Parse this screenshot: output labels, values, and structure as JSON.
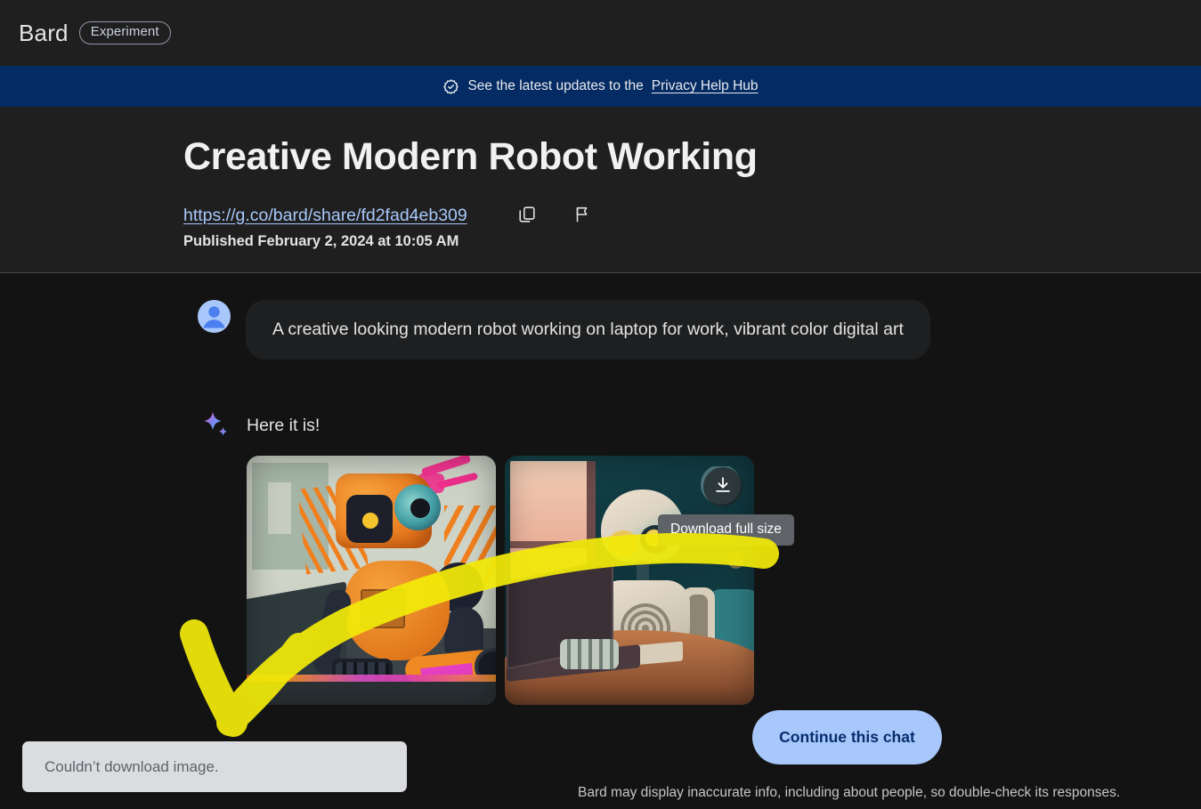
{
  "appbar": {
    "brand": "Bard",
    "chip": "Experiment",
    "brand_icon": "bard-logo"
  },
  "banner": {
    "icon": "verified-badge-icon",
    "text": "See the latest updates to the",
    "link": "Privacy Help Hub",
    "background_color": "#042b63"
  },
  "hero": {
    "title": "Creative Modern Robot Working",
    "share_url": "https://g.co/bard/share/fd2fad4eb309",
    "copy_icon": "copy-icon",
    "flag_icon": "flag-icon",
    "published": "Published February 2, 2024 at 10:05 AM",
    "link_color": "#a8c7fa"
  },
  "conversation": {
    "user": {
      "avatar_icon": "user-avatar-icon",
      "prompt": "A creative looking modern robot working on laptop for work, vibrant color digital art"
    },
    "model": {
      "sparkle_icon": "bard-sparkle-icon",
      "response": "Here it is!"
    },
    "images": [
      {
        "alt": "Orange robot working at a laptop, digital art"
      },
      {
        "alt": "Teal and cream robot typing on a laptop, digital art"
      }
    ],
    "download_button": {
      "icon": "download-icon",
      "tooltip": "Download full size"
    }
  },
  "footer": {
    "continue_label": "Continue this chat",
    "continue_color": "#a8c7fa",
    "disclaimer": "Bard may display inaccurate info, including about people, so double-check its responses."
  },
  "toast": {
    "message": "Couldn’t download image.",
    "background_color": "#dadce0"
  },
  "annotation": {
    "type": "arrow",
    "color": "#f2ea0a",
    "description": "Yellow highlighter arrow curving from the right image down-left to the toast"
  }
}
